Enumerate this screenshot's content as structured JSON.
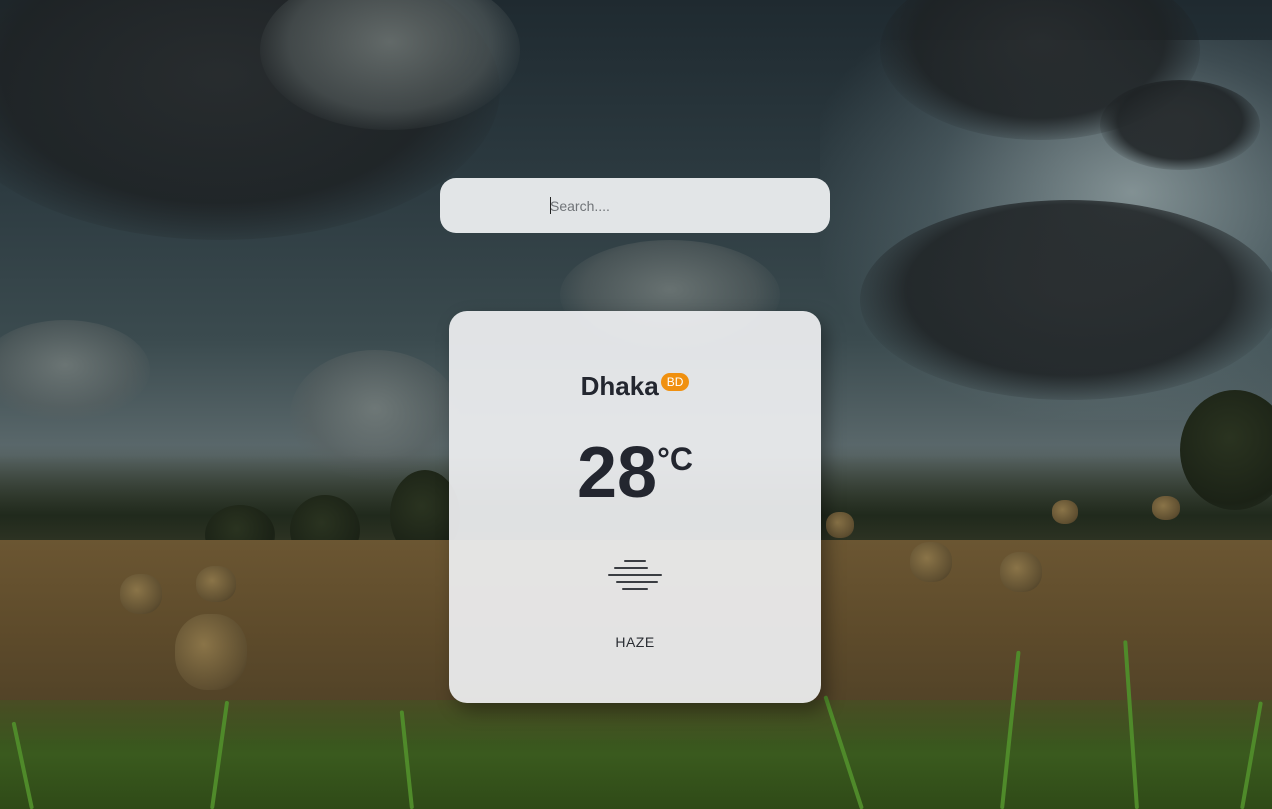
{
  "search": {
    "placeholder": "Search...."
  },
  "weather": {
    "city": "Dhaka",
    "country": "BD",
    "temperature": "28",
    "unit": "°C",
    "icon": "haze-icon",
    "description": "HAZE"
  },
  "colors": {
    "badge": "#f0900f",
    "text": "#23262f",
    "card": "#eeeff1"
  }
}
